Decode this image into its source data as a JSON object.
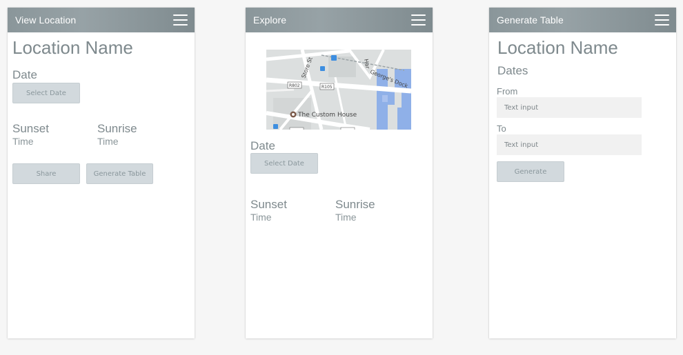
{
  "screens": {
    "view_location": {
      "title": "View Location",
      "location_name": "Location Name",
      "date_label": "Date",
      "select_date_label": "Select Date",
      "sunset_label": "Sunset",
      "sunset_value": "Time",
      "sunrise_label": "Sunrise",
      "sunrise_value": "Time",
      "share_label": "Share",
      "generate_table_label": "Generate Table"
    },
    "explore": {
      "title": "Explore",
      "map": {
        "streets": [
          "Store St",
          "George's Dock",
          "Har"
        ],
        "road_codes": [
          "R802",
          "R105"
        ],
        "place": "The Custom House"
      },
      "date_label": "Date",
      "select_date_label": "Select Date",
      "sunset_label": "Sunset",
      "sunset_value": "Time",
      "sunrise_label": "Sunrise",
      "sunrise_value": "Time"
    },
    "generate_table": {
      "title": "Generate Table",
      "location_name": "Location Name",
      "dates_label": "Dates",
      "from_label": "From",
      "from_placeholder": "Text input",
      "to_label": "To",
      "to_placeholder": "Text input",
      "generate_label": "Generate"
    }
  },
  "icons": {
    "menu": "hamburger-menu-icon"
  },
  "colors": {
    "appbar": "#8a969a",
    "button_bg": "#d2d9dd",
    "text": "#7e898d",
    "map_water": "#8fb0e8"
  }
}
